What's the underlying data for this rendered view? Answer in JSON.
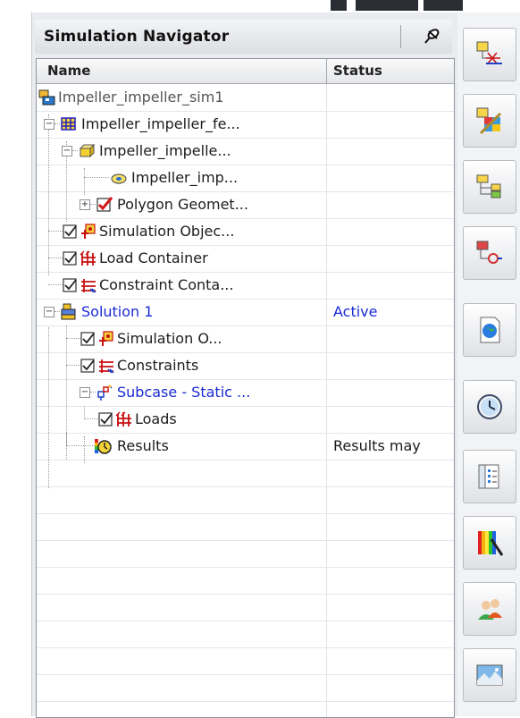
{
  "navigator": {
    "title": "Simulation Navigator",
    "columns": {
      "name": "Name",
      "status": "Status"
    },
    "rows": [
      {
        "label": "Impeller_impeller_sim1",
        "status": "",
        "icon": "sim-file-icon",
        "active": false
      },
      {
        "label": "Impeller_impeller_fe...",
        "status": "",
        "icon": "fem-mesh-icon",
        "active": false
      },
      {
        "label": "Impeller_impelle...",
        "status": "",
        "icon": "part-box-icon",
        "active": false
      },
      {
        "label": "Impeller_imp...",
        "status": "",
        "icon": "body-icon",
        "active": false
      },
      {
        "label": "Polygon Geomet...",
        "status": "",
        "icon": "checkbox-checked-icon",
        "active": false
      },
      {
        "label": "Simulation Objec...",
        "status": "",
        "icon": "simulation-object-icon",
        "active": false
      },
      {
        "label": "Load Container",
        "status": "",
        "icon": "load-container-icon",
        "active": false
      },
      {
        "label": "Constraint Conta...",
        "status": "",
        "icon": "constraint-container-icon",
        "active": false
      },
      {
        "label": "Solution 1",
        "status": "Active",
        "icon": "solution-icon",
        "active": true
      },
      {
        "label": "Simulation O...",
        "status": "",
        "icon": "simulation-object-icon",
        "active": false
      },
      {
        "label": "Constraints",
        "status": "",
        "icon": "constraint-container-icon",
        "active": false
      },
      {
        "label": "Subcase - Static ...",
        "status": "",
        "icon": "subcase-icon",
        "active": true
      },
      {
        "label": "Loads",
        "status": "",
        "icon": "load-container-icon",
        "active": false
      },
      {
        "label": "Results",
        "status": "Results may",
        "icon": "results-icon",
        "active": false
      }
    ]
  },
  "toolbar": {
    "tools": [
      "simulation-navigator-icon",
      "fem-editor-icon",
      "part-navigator-icon",
      "assembly-navigator-icon",
      "web-browser-icon",
      "history-icon",
      "roles-list-icon",
      "palette-icon",
      "users-icon",
      "landscape-icon"
    ]
  },
  "colors": {
    "active_text": "#1a2bd6",
    "panel_bg": "#e9ebee"
  }
}
